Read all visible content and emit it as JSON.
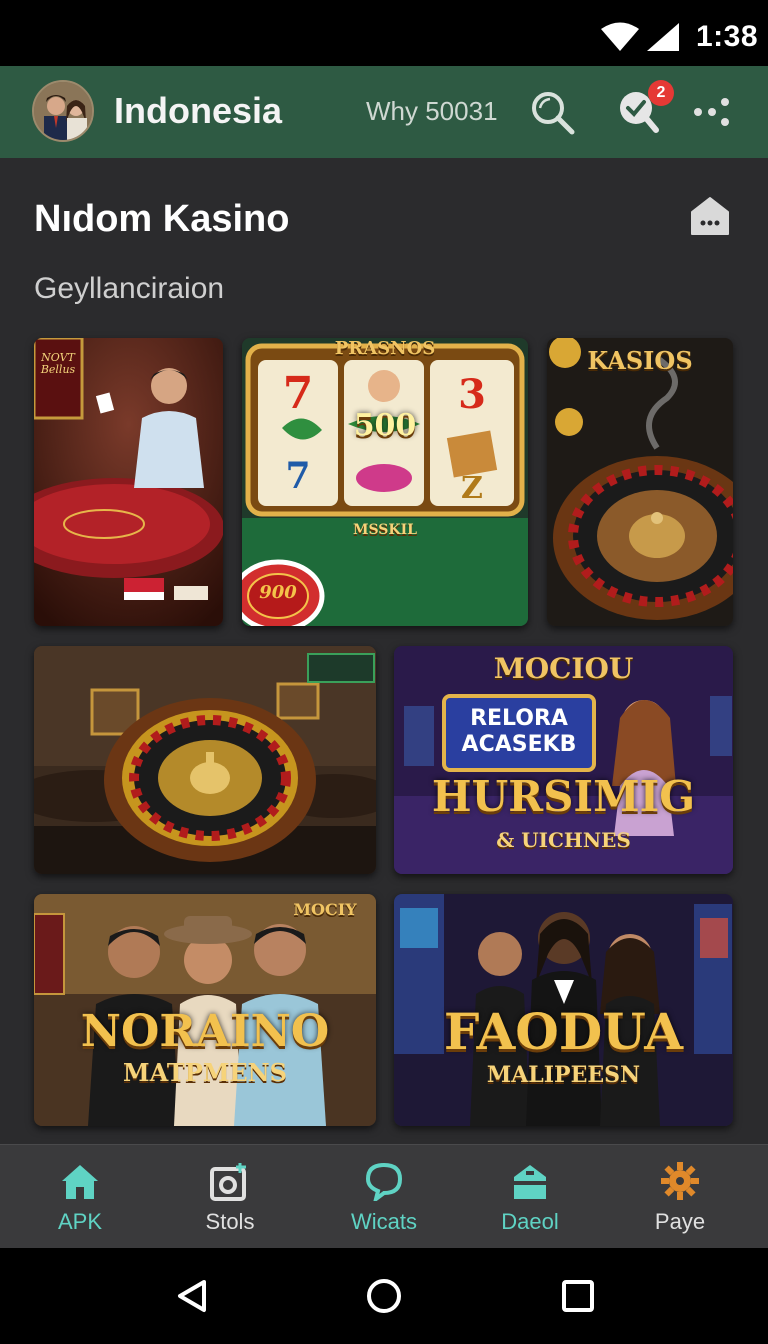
{
  "status_bar": {
    "time": "1:38",
    "wifi_icon": "wifi-icon",
    "signal_icon": "signal-icon"
  },
  "app_bar": {
    "title": "Indonesia",
    "meta": "Why 50031",
    "notification_count": "2",
    "icons": [
      "avatar",
      "search-icon",
      "notification-icon",
      "more-icon"
    ],
    "color": "#2e5a43"
  },
  "section": {
    "title": "Nıdom Kasino",
    "subtitle": "Geyllanciraion",
    "icon": "home-badge-icon"
  },
  "tiles": [
    {
      "top_label": "",
      "main_label": "",
      "sub_label": "",
      "corner_text": "NOVT Bellus"
    },
    {
      "top_label": "PRASNOS",
      "main_label": "500",
      "sub_label": "MSSKIL",
      "chip_text": "900"
    },
    {
      "top_label": "KASIOS",
      "main_label": "",
      "sub_label": ""
    },
    {
      "top_label": "",
      "main_label": "",
      "sub_label": ""
    },
    {
      "top_label": "MOCIOU",
      "main_label": "HURSIMIG",
      "sub_label": "& UICHNES",
      "panel_text": "RELORA\nACASEKB"
    },
    {
      "top_label": "MOCIY",
      "main_label": "NORAINO",
      "sub_label": "MATPMENS"
    },
    {
      "top_label": "",
      "main_label": "FAODUA",
      "sub_label": "MALIPEESN"
    }
  ],
  "bottom_nav": [
    {
      "label": "APK",
      "icon": "home-icon",
      "color": "#5fd3c4"
    },
    {
      "label": "Stols",
      "icon": "camera-icon",
      "color": "#e0e0e0"
    },
    {
      "label": "Wicats",
      "icon": "chat-icon",
      "color": "#5fd3c4"
    },
    {
      "label": "Daeol",
      "icon": "inbox-icon",
      "color": "#5fd3c4"
    },
    {
      "label": "Paye",
      "icon": "gear-icon",
      "color": "#e0e0e0"
    }
  ],
  "system_nav": [
    "back-icon",
    "home-circle-icon",
    "recents-icon"
  ]
}
